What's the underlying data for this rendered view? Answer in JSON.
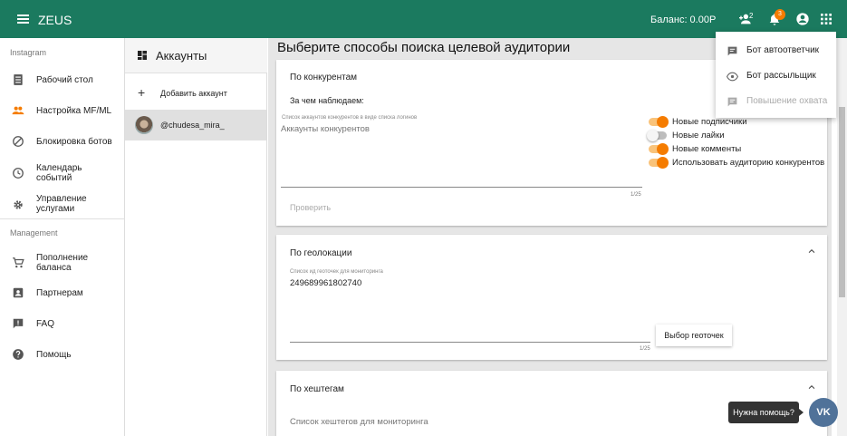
{
  "app": {
    "title": "ZEUS",
    "balance": "Баланс: 0.00Р",
    "friend_badge": "2",
    "notif_count": "3"
  },
  "sidebar": {
    "section_instagram": "Instagram",
    "items_instagram": [
      {
        "label": "Рабочий стол",
        "icon": "dashboard-icon"
      },
      {
        "label": "Настройка MF/ML",
        "icon": "people-icon",
        "active": true
      },
      {
        "label": "Блокировка ботов",
        "icon": "block-icon"
      },
      {
        "label": "Календарь событий",
        "icon": "clock-icon"
      },
      {
        "label": "Управление услугами",
        "icon": "gear-icon"
      }
    ],
    "section_management": "Management",
    "items_management": [
      {
        "label": "Пополнение баланса",
        "icon": "cart-icon"
      },
      {
        "label": "Партнерам",
        "icon": "contact-icon"
      },
      {
        "label": "FAQ",
        "icon": "feedback-icon"
      },
      {
        "label": "Помощь",
        "icon": "help-icon"
      }
    ]
  },
  "accounts": {
    "title": "Аккаунты",
    "add_label": "Добавить аккаунт",
    "selected_account": "@chudesa_mira_"
  },
  "main": {
    "title": "Выберите способы поиска целевой аудитории",
    "competitors": {
      "title": "По конкурентам",
      "watch_label": "За чем наблюдаем:",
      "input_label": "Список аккаунтов конкурентов в виде списка логинов",
      "input_placeholder": "Аккаунты конкурентов",
      "counter": "1/25",
      "check_button": "Проверить",
      "toggles": [
        {
          "label": "Новые подписчики",
          "on": true
        },
        {
          "label": "Новые лайки",
          "on": false
        },
        {
          "label": "Новые комменты",
          "on": true
        },
        {
          "label": "Использовать аудиторию конкурентов",
          "on": true
        }
      ]
    },
    "geo": {
      "title": "По геолокации",
      "input_label": "Список ид геоточек для мониторинга",
      "input_value": "249689961802740",
      "counter": "1/25",
      "button": "Выбор геоточек"
    },
    "hashtags": {
      "title": "По хештегам",
      "input_placeholder": "Список хештегов для мониторинга"
    }
  },
  "dropdown": {
    "items": [
      {
        "label": "Бот автоответчик",
        "disabled": false
      },
      {
        "label": "Бот рассыльщик",
        "disabled": false
      },
      {
        "label": "Повышение охвата",
        "disabled": true
      }
    ]
  },
  "help": {
    "tooltip": "Нужна помощь?",
    "vk_label": "VK"
  },
  "colors": {
    "primary": "#1b7a5f",
    "accent": "#f57c00"
  }
}
